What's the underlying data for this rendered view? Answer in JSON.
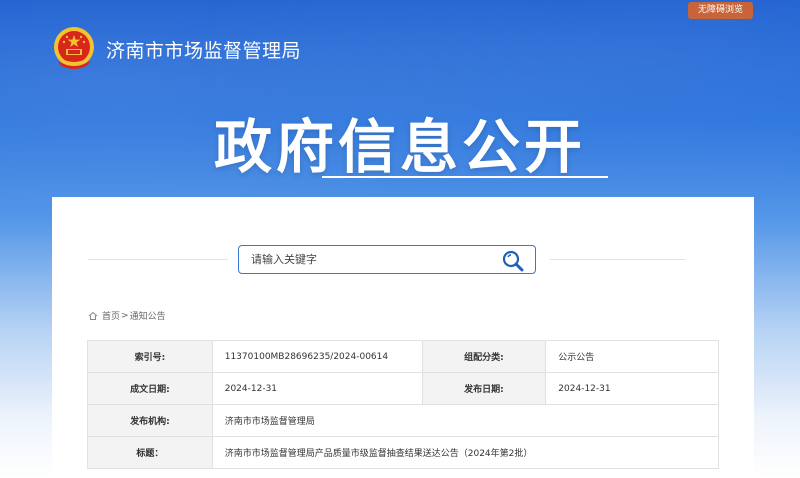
{
  "header": {
    "accessibility_label": "无障碍浏览",
    "org_name": "济南市市场监督管理局",
    "hero_title": "政府信息公开"
  },
  "search": {
    "placeholder": "请输入关键字"
  },
  "breadcrumb": {
    "home": "首页",
    "separator": ">",
    "current": "通知公告"
  },
  "info": {
    "index_label": "索引号:",
    "index_value": "11370100MB28696235/2024-00614",
    "category_label": "组配分类:",
    "category_value": "公示公告",
    "written_label": "成文日期:",
    "written_value": "2024-12-31",
    "published_label": "发布日期:",
    "published_value": "2024-12-31",
    "issuer_label": "发布机构:",
    "issuer_value": "济南市市场监督管理局",
    "title_label": "标题：",
    "title_value": "济南市市场监督管理局产品质量市级监督抽查结果送达公告（2024年第2批）"
  },
  "colors": {
    "primary_blue": "#2b74dd",
    "accent_orange": "#c8643a",
    "search_border": "#3b77d2"
  }
}
